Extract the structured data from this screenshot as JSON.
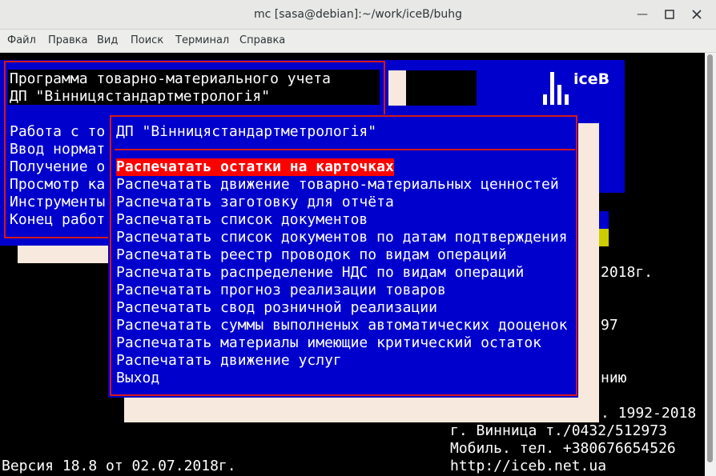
{
  "window": {
    "title": "mc [sasa@debian]:~/work/iceB/buhg"
  },
  "menubar": {
    "items": [
      "Файл",
      "Правка",
      "Вид",
      "Поиск",
      "Терминал",
      "Справка"
    ]
  },
  "header": {
    "line1": "Программа товарно-материального учета",
    "line2": "ДП \"Вінницястандартметрологія\"",
    "logo": "iceB"
  },
  "back_menu": {
    "items": [
      "Работа с то",
      "Ввод нормат",
      "Получение о",
      "Просмотр ка",
      "Инструменты",
      "Конец работ"
    ]
  },
  "popup": {
    "title": "ДП \"Вінницястандартметрологія\"",
    "selected_index": 0,
    "items": [
      "Распечатать остатки на карточках",
      "Распечатать движение товарно-материальных ценностей",
      "Распечатать заготовку для отчёта",
      "Распечатать список документов",
      "Распечатать список документов по датам подтверждения",
      "Распечатать реестр проводок по видам операций",
      "Распечатать распределение НДС по видам операций",
      "Распечатать прогноз реализации товаров",
      "Распечатать свод розничной реализации",
      "Распечатать суммы выполненых автоматических дооценок",
      "Распечатать материалы имеющие критический остаток",
      "Распечатать движение услуг",
      "Выход"
    ]
  },
  "background_text": {
    "r1": "2018г.",
    "r2": "97",
    "r3": "нию",
    "r4": ". 1992-2018",
    "r5": "г. Винница т./0432/512973",
    "r6": "Мобиль. тел. +380676654526",
    "r7": "http://iceb.net.ua",
    "version": "Версия 18.8 от 02.07.2018г."
  },
  "colors": {
    "blue": "#0000cc",
    "red": "#d41919",
    "highlight": "#ff0000",
    "cream": "#f7e9dd",
    "yellow": "#cccc00"
  }
}
